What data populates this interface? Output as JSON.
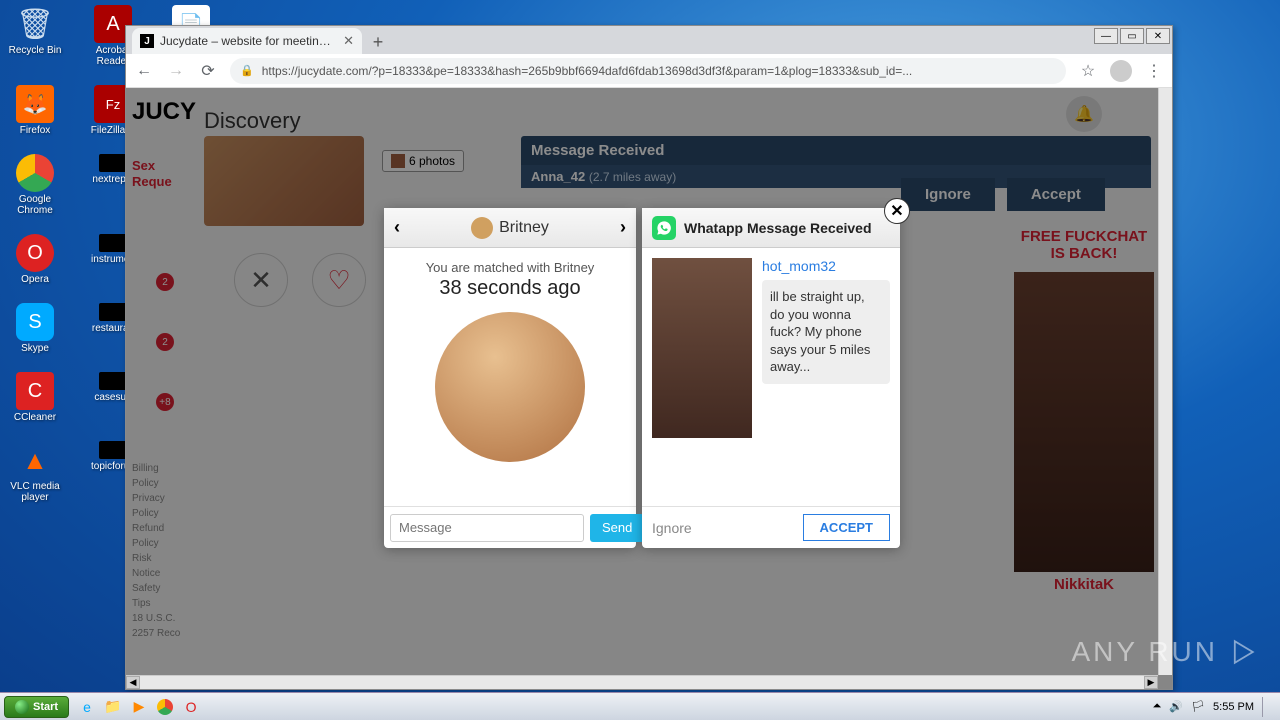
{
  "desktop_icons": {
    "row1": [
      {
        "label": "Recycle Bin",
        "glyph": "🗑"
      },
      {
        "label": "Acrobat Reader",
        "glyph": "A"
      },
      {
        "label": "",
        "glyph": "📄"
      }
    ],
    "col": [
      {
        "label": "Firefox",
        "glyph": "🦊"
      },
      {
        "label": "Google Chrome",
        "glyph": "⬤"
      },
      {
        "label": "Opera",
        "glyph": "O"
      },
      {
        "label": "Skype",
        "glyph": "S"
      },
      {
        "label": "CCleaner",
        "glyph": "🧹"
      },
      {
        "label": "VLC media player",
        "glyph": "▲"
      }
    ],
    "col2": [
      {
        "label": "FileZilla C",
        "glyph": "Fz"
      },
      {
        "label": "nextrepal",
        "glyph": ""
      },
      {
        "label": "instrumen",
        "glyph": ""
      },
      {
        "label": "restauran",
        "glyph": ""
      },
      {
        "label": "casesup",
        "glyph": ""
      },
      {
        "label": "topicforun",
        "glyph": ""
      }
    ]
  },
  "window": {
    "min": "—",
    "max": "▭",
    "close": "✕"
  },
  "tab": {
    "title": "Jucydate – website for meetings! C"
  },
  "url": "https://jucydate.com/?p=18333&pe=18333&hash=265b9bbf6694dafd6fdab13698d3df3f&param=1&plog=18333&sub_id=...",
  "page": {
    "logo": "JUCY",
    "discovery": "Discovery",
    "sidebar_btn": "Sex Reque",
    "badges": [
      "2",
      "2",
      "+8"
    ],
    "photos_badge": "6 photos",
    "footer": "Billing\nPolicy\nPrivacy\nPolicy\nRefund\nPolicy\nRisk\nNotice\nSafety\nTips\n18 U.S.C.\n2257 Reco",
    "msg_received": {
      "title": "Message Received",
      "user": "Anna_42",
      "dist": "(2.7 miles away)",
      "ignore": "Ignore",
      "accept": "Accept"
    },
    "right_ad": {
      "caption": "FREE FUCKCHAT IS BACK!",
      "name": "NikkitaK"
    }
  },
  "popup_left": {
    "name": "Britney",
    "matched": "You are matched with Britney",
    "time": "38 seconds ago",
    "placeholder": "Message",
    "send": "Send"
  },
  "popup_right": {
    "title": "Whatapp Message Received",
    "user": "hot_mom32",
    "bubble": "ill be straight up, do you wonna fuck? My phone says your 5 miles away...",
    "ignore": "Ignore",
    "accept": "ACCEPT"
  },
  "watermark": "ANY    RUN",
  "taskbar": {
    "start": "Start",
    "clock": "5:55 PM"
  }
}
